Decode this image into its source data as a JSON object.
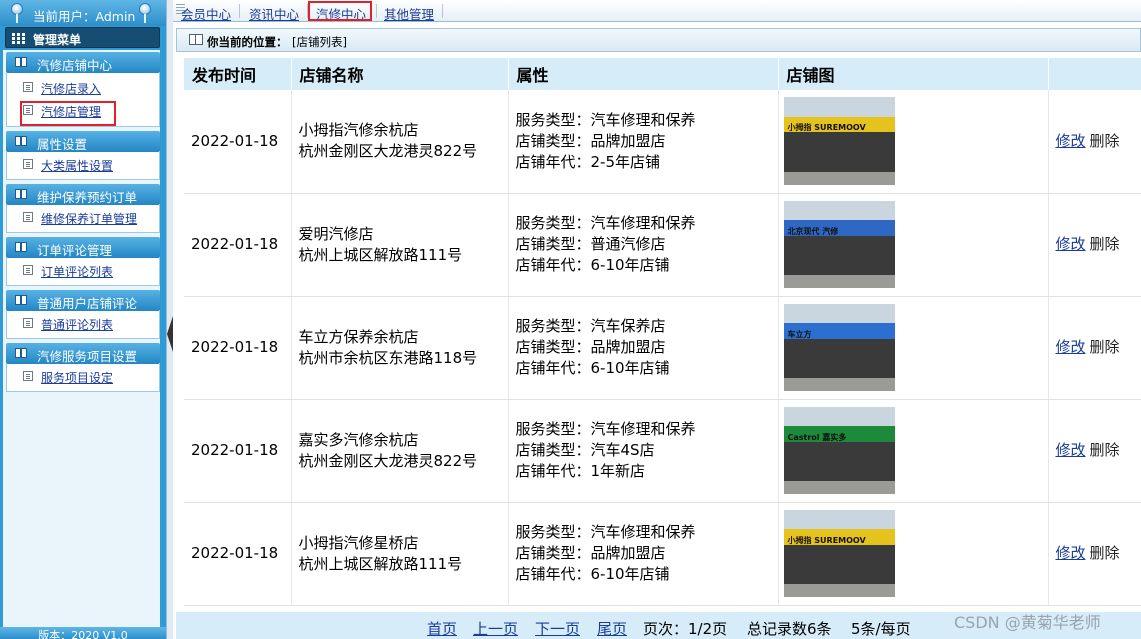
{
  "header": {
    "current_user": "当前用户：Admin"
  },
  "sidebar": {
    "menu_title": "管理菜单",
    "groups": [
      {
        "title": "汽修店铺中心",
        "items": [
          "汽修店录入",
          "汽修店管理"
        ]
      },
      {
        "title": "属性设置",
        "items": [
          "大类属性设置"
        ]
      },
      {
        "title": "维护保养预约订单",
        "items": [
          "维修保养订单管理"
        ]
      },
      {
        "title": "订单评论管理",
        "items": [
          "订单评论列表"
        ]
      },
      {
        "title": "普通用户店铺评论",
        "items": [
          "普通评论列表"
        ]
      },
      {
        "title": "汽修服务项目设置",
        "items": [
          "服务项目设定"
        ]
      }
    ],
    "version": "版本：2020 V1.0"
  },
  "nav": {
    "items": [
      "会员中心",
      "资讯中心",
      "汽修中心",
      "其他管理"
    ],
    "active": "汽修中心"
  },
  "location": {
    "label": "你当前的位置：",
    "value": "[店铺列表]"
  },
  "table": {
    "headers": [
      "发布时间",
      "店铺名称",
      "属性",
      "店铺图",
      ""
    ],
    "rows": [
      {
        "date": "2022-01-18",
        "name": "小拇指汽修余杭店",
        "address": "杭州金刚区大龙港灵822号",
        "attr": [
          "服务类型：汽车修理和保养",
          "店铺类型：品牌加盟店",
          "店铺年代：2-5年店铺"
        ],
        "img_sign": "小拇指 SUREMOOV",
        "img_color": "#e6c21c",
        "edit": "修改",
        "delete": "删除"
      },
      {
        "date": "2022-01-18",
        "name": "爱明汽修店",
        "address": "杭州上城区解放路111号",
        "attr": [
          "服务类型：汽车修理和保养",
          "店铺类型：普通汽修店",
          "店铺年代：6-10年店铺"
        ],
        "img_sign": "北京现代 汽修",
        "img_color": "#2f67c4",
        "edit": "修改",
        "delete": "删除"
      },
      {
        "date": "2022-01-18",
        "name": "车立方保养余杭店",
        "address": "杭州市余杭区东港路118号",
        "attr": [
          "服务类型：汽车保养店",
          "店铺类型：品牌加盟店",
          "店铺年代：6-10年店铺"
        ],
        "img_sign": "车立方",
        "img_color": "#2d6fd0",
        "edit": "修改",
        "delete": "删除"
      },
      {
        "date": "2022-01-18",
        "name": "嘉实多汽修余杭店",
        "address": "杭州金刚区大龙港灵822号",
        "attr": [
          "服务类型：汽车修理和保养",
          "店铺类型：汽车4S店",
          "店铺年代：1年新店"
        ],
        "img_sign": "Castrol 嘉实多",
        "img_color": "#1c8a3a",
        "edit": "修改",
        "delete": "删除"
      },
      {
        "date": "2022-01-18",
        "name": "小拇指汽修星桥店",
        "address": "杭州上城区解放路111号",
        "attr": [
          "服务类型：汽车修理和保养",
          "店铺类型：品牌加盟店",
          "店铺年代：6-10年店铺"
        ],
        "img_sign": "小拇指 SUREMOOV",
        "img_color": "#e6c21c",
        "edit": "修改",
        "delete": "删除"
      }
    ]
  },
  "pager": {
    "first": "首页",
    "prev": "上一页",
    "next": "下一页",
    "last": "尾页",
    "page_info": "页次：1/2页",
    "total": "总记录数6条",
    "per_page": "5条/每页"
  },
  "watermark": "CSDN @黄菊华老师",
  "colors": {
    "sidebar_blue": "#2e9bd6",
    "header_bg": "#d6ecf8",
    "link": "#1a3c9a",
    "highlight_red": "#e0212c"
  }
}
